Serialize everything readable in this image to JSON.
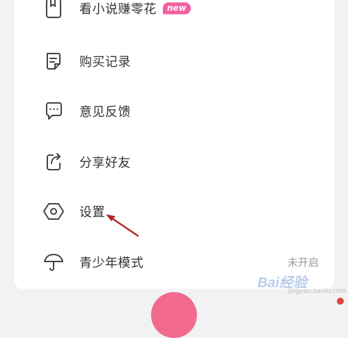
{
  "menu": {
    "items": [
      {
        "label": "看小说赚零花",
        "icon": "bookmark-book-icon",
        "badge": "new"
      },
      {
        "label": "购买记录",
        "icon": "purchase-record-icon"
      },
      {
        "label": "意见反馈",
        "icon": "feedback-chat-icon"
      },
      {
        "label": "分享好友",
        "icon": "share-icon"
      },
      {
        "label": "设置",
        "icon": "settings-hexagon-icon"
      },
      {
        "label": "青少年模式",
        "icon": "umbrella-icon",
        "status": "未开启"
      }
    ]
  },
  "watermark": {
    "text": "Bai经验",
    "sub": "jingyan.baidu.com"
  },
  "colors": {
    "badge": "#f35ea0",
    "annotation_arrow": "#b3262a",
    "bottom_button": "#f26a8e"
  }
}
